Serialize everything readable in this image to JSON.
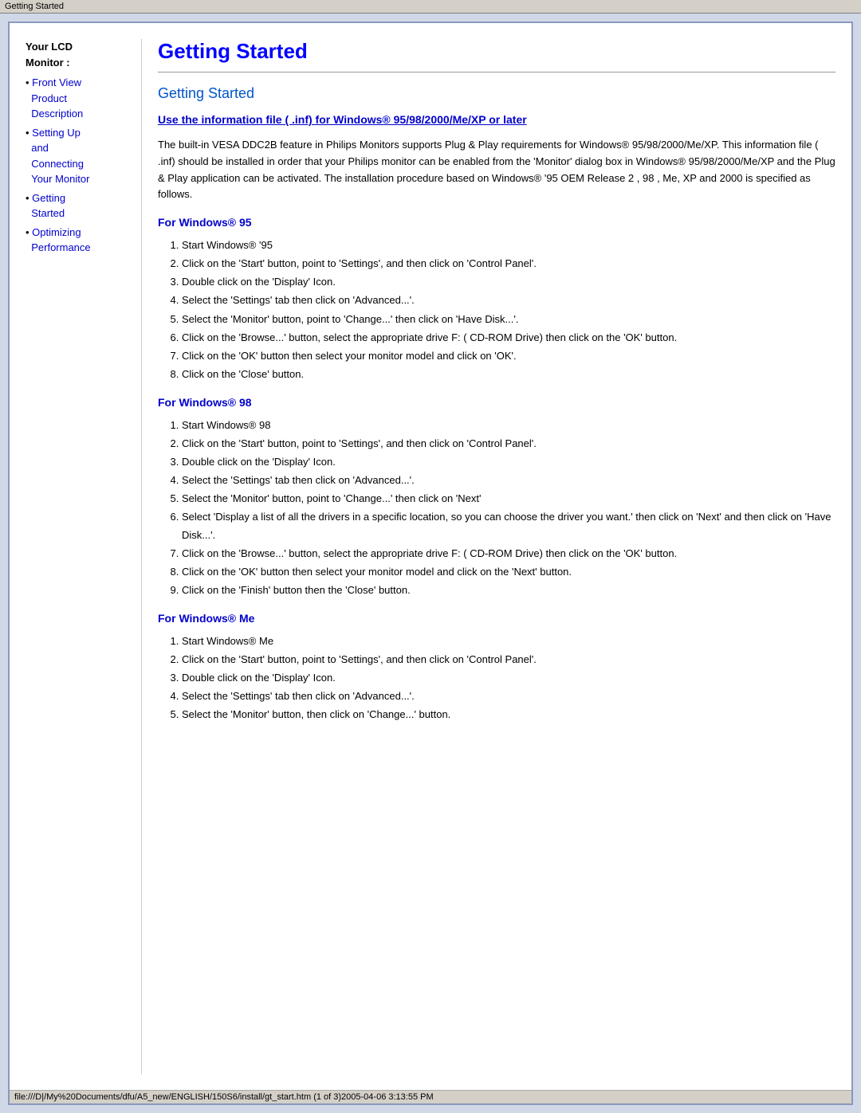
{
  "title_bar": "Getting Started",
  "sidebar": {
    "heading_line1": "Your LCD",
    "heading_line2": "Monitor",
    "heading_colon": ":",
    "nav_items": [
      {
        "bullet": "•",
        "text": "Front View Product Description",
        "href": "#"
      },
      {
        "bullet": "•",
        "text": "Setting Up and Connecting Your Monitor",
        "href": "#"
      },
      {
        "bullet": "•",
        "text": "Getting Started",
        "href": "#"
      },
      {
        "bullet": "•",
        "text": "Optimizing Performance",
        "href": "#"
      }
    ]
  },
  "main": {
    "page_title": "Getting Started",
    "section_title": "Getting Started",
    "inf_link_text": "Use the information file ( .inf) for Windows® 95/98/2000/Me/XP or later",
    "intro_text": "The built-in VESA DDC2B feature in Philips Monitors supports Plug & Play requirements for Windows® 95/98/2000/Me/XP. This information file ( .inf) should be installed in order that your Philips monitor can be enabled from the 'Monitor' dialog box in Windows® 95/98/2000/Me/XP and the Plug & Play application can be activated. The installation procedure based on Windows® '95 OEM Release 2 , 98 , Me, XP and 2000 is specified as follows.",
    "sections": [
      {
        "heading": "For Windows® 95",
        "steps": [
          "Start Windows® '95",
          "Click on the 'Start' button, point to 'Settings', and then click on 'Control Panel'.",
          "Double click on the 'Display' Icon.",
          "Select the 'Settings' tab then click on 'Advanced...'.",
          "Select the 'Monitor' button, point to 'Change...' then click on 'Have Disk...'.",
          "Click on the 'Browse...' button, select the appropriate drive F: ( CD-ROM Drive) then click on the 'OK' button.",
          "Click on the 'OK' button then select your monitor model and click on 'OK'.",
          "Click on the 'Close' button."
        ]
      },
      {
        "heading": "For Windows® 98",
        "steps": [
          "Start Windows® 98",
          "Click on the 'Start' button, point to 'Settings', and then click on 'Control Panel'.",
          "Double click on the 'Display' Icon.",
          "Select the 'Settings' tab then click on 'Advanced...'.",
          "Select the 'Monitor' button, point to 'Change...' then click on 'Next'",
          "Select 'Display a list of all the drivers in a specific location, so you can choose the driver you want.' then click on 'Next' and then click on 'Have Disk...'.",
          "Click on the 'Browse...' button, select the appropriate drive F: ( CD-ROM Drive) then click on the 'OK' button.",
          "Click on the 'OK' button then select your monitor model and click on the 'Next' button.",
          "Click on the 'Finish' button then the 'Close' button."
        ]
      },
      {
        "heading": "For Windows® Me",
        "steps": [
          "Start Windows® Me",
          "Click on the 'Start' button, point to 'Settings', and then click on 'Control Panel'.",
          "Double click on the 'Display' Icon.",
          "Select the 'Settings' tab then click on 'Advanced...'.",
          "Select the 'Monitor' button, then click on 'Change...' button."
        ]
      }
    ]
  },
  "status_bar": "file:///D|/My%20Documents/dfu/A5_new/ENGLISH/150S6/install/gt_start.htm (1 of 3)2005-04-06 3:13:55 PM"
}
